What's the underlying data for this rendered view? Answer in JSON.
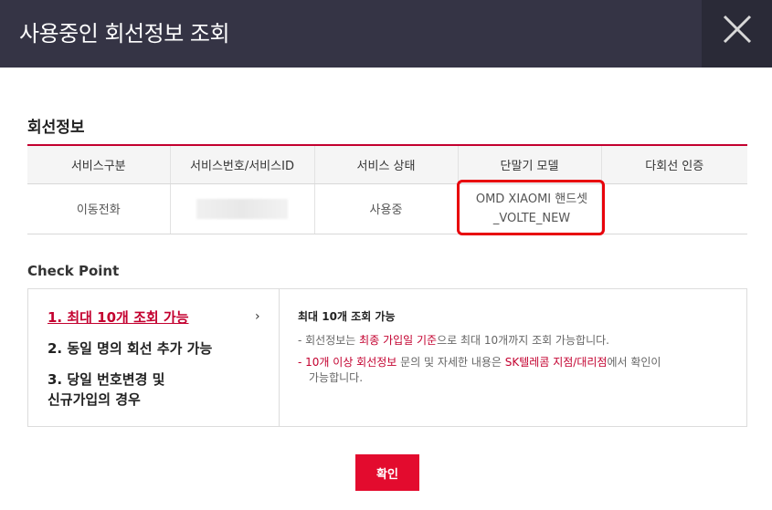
{
  "header": {
    "title": "사용중인 회선정보 조회"
  },
  "line_info": {
    "section_title": "회선정보",
    "columns": [
      "서비스구분",
      "서비스번호/서비스ID",
      "서비스 상태",
      "단말기 모델",
      "다회선 인증"
    ],
    "row": {
      "service_type": "이동전화",
      "service_status": "사용중",
      "device_line1": "OMD XIAOMI 핸드셋",
      "device_line2": "_VOLTE_NEW",
      "multi_line_auth": ""
    }
  },
  "check_point": {
    "title": "Check Point",
    "items": [
      {
        "label": "1. 최대 10개 조회 가능"
      },
      {
        "label_line1": "2. 동일 명의 회선 추가 가능"
      },
      {
        "label_line1": "3. 당일 번호변경 및",
        "label_line2": "신규가입의 경우"
      }
    ],
    "arrow": "›",
    "detail": {
      "title": "최대 10개 조회 가능",
      "line1_pre": "- 회선정보는 ",
      "line1_red": "최종 가입일 기준",
      "line1_post": "으로 최대 10개까지 조회 가능합니다.",
      "line2_red1": "10개 이상 회선정보",
      "line2_mid": " 문의 및 자세한 내용은 ",
      "line2_red2": "SK텔레콤 지점/대리점",
      "line2_post": "에서 확인이",
      "line3": "가능합니다."
    }
  },
  "confirm_label": "확인"
}
